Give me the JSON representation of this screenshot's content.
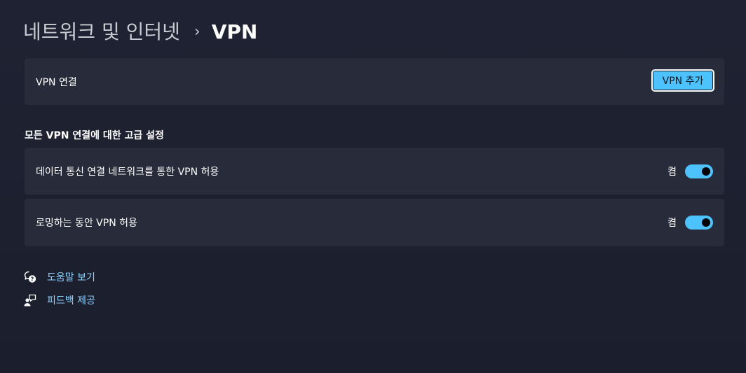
{
  "header": {
    "breadcrumb_parent": "네트워크 및 인터넷",
    "breadcrumb_separator": "›",
    "breadcrumb_current": "VPN"
  },
  "vpn_connections": {
    "label": "VPN 연결",
    "add_button_label": "VPN 추가"
  },
  "advanced": {
    "section_title": "모든 VPN 연결에 대한 고급 설정",
    "settings": [
      {
        "label": "데이터 통신 연결 네트워크를 통한 VPN 허용",
        "state_text": "켬",
        "enabled": true
      },
      {
        "label": "로밍하는 동안 VPN 허용",
        "state_text": "켬",
        "enabled": true
      }
    ]
  },
  "links": {
    "help_label": "도움말 보기",
    "help_icon": "help-chat-icon",
    "feedback_label": "피드백 제공",
    "feedback_icon": "feedback-person-icon"
  },
  "colors": {
    "accent": "#4cc2ff",
    "link": "#8fd3ff",
    "card_bg": "#272b3a",
    "page_bg": "#1c2030"
  }
}
